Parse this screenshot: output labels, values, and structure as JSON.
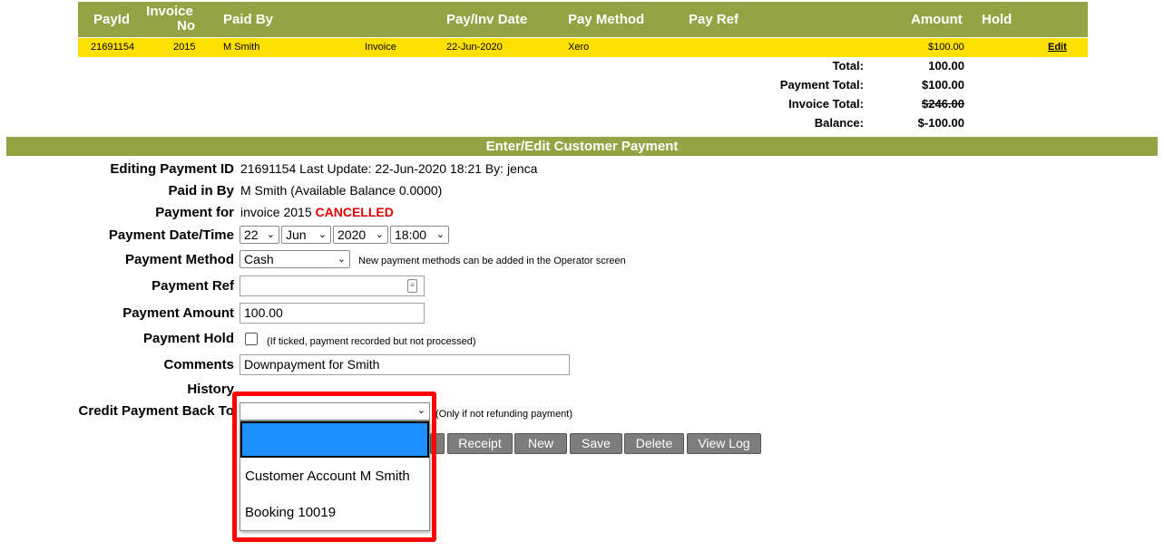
{
  "payments_table": {
    "headers": {
      "payid": "PayId",
      "invoice_no_1": "Invoice",
      "invoice_no_2": "No",
      "paid_by": "Paid By",
      "pay_inv_date": "Pay/Inv Date",
      "pay_method": "Pay Method",
      "pay_ref": "Pay Ref",
      "amount": "Amount",
      "hold": "Hold"
    },
    "row": {
      "payid": "21691154",
      "invoice_no": "2015",
      "paid_by": "M Smith",
      "type": "Invoice",
      "date": "22-Jun-2020",
      "method": "Xero",
      "amount": "$100.00",
      "edit": "Edit"
    }
  },
  "totals": {
    "total_label": "Total:",
    "total_value": "100.00",
    "payment_total_label": "Payment Total:",
    "payment_total_value": "$100.00",
    "invoice_total_label": "Invoice Total:",
    "invoice_total_value": "$246.00",
    "balance_label": "Balance:",
    "balance_value": "$-100.00"
  },
  "section_title": "Enter/Edit Customer Payment",
  "form": {
    "editing_label": "Editing Payment ID",
    "editing_value": "21691154 Last Update: 22-Jun-2020 18:21 By: jenca",
    "paid_by_label": "Paid in By",
    "paid_by_value": "M Smith (Available Balance 0.0000)",
    "payment_for_label": "Payment for",
    "payment_for_value": "invoice 2015",
    "payment_for_status": "CANCELLED",
    "date_label": "Payment Date/Time",
    "date_day": "22",
    "date_month": "Jun",
    "date_year": "2020",
    "date_time": "18:00",
    "method_label": "Payment Method",
    "method_value": "Cash",
    "method_note": "New payment methods can be added in the Operator screen",
    "ref_label": "Payment Ref",
    "ref_value": "",
    "amount_label": "Payment Amount",
    "amount_value": "100.00",
    "hold_label": "Payment Hold",
    "hold_note": "(If ticked, payment recorded but not processed)",
    "comments_label": "Comments",
    "comments_value": "Downpayment for Smith",
    "history_label": "History",
    "credit_label": "Credit Payment Back To",
    "credit_note": "(Only if not refunding payment)"
  },
  "buttons": {
    "receipt": "Receipt",
    "new": "New",
    "save": "Save",
    "delete": "Delete",
    "view_log": "View Log"
  },
  "dropdown": {
    "options": [
      "",
      "Customer Account M Smith",
      "Booking 10019"
    ],
    "highlight_color": "#1e90ff",
    "annotation_color": "#ff0000"
  },
  "colors": {
    "header_green": "#94a444",
    "row_yellow": "#ffe100",
    "button_gray": "#7d7d7d"
  }
}
